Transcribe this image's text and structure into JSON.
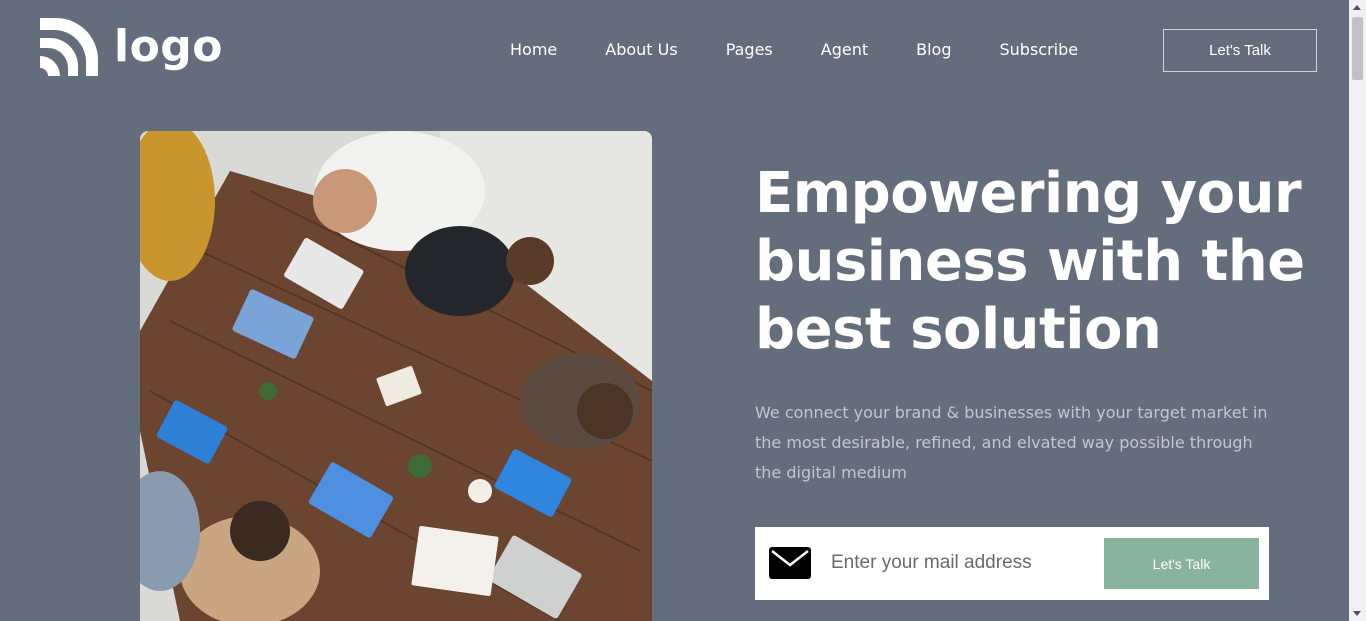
{
  "header": {
    "logo_text": "logo",
    "logo_icon": "signal-arcs-icon",
    "nav": [
      "Home",
      "About Us",
      "Pages",
      "Agent",
      "Blog",
      "Subscribe"
    ],
    "cta_label": "Let's Talk"
  },
  "hero": {
    "title": "Empowering your business with the best solution",
    "subtitle": "We connect your brand & businesses with your target market in the most desirable, refined, and elvated way possible through the digital medium"
  },
  "subscribe": {
    "icon": "mail-icon",
    "placeholder": "Enter your mail address",
    "button_label": "Let's Talk"
  },
  "colors": {
    "background": "#646d7b",
    "accent_button": "#88b49d",
    "text_muted": "#c2c7cf"
  }
}
